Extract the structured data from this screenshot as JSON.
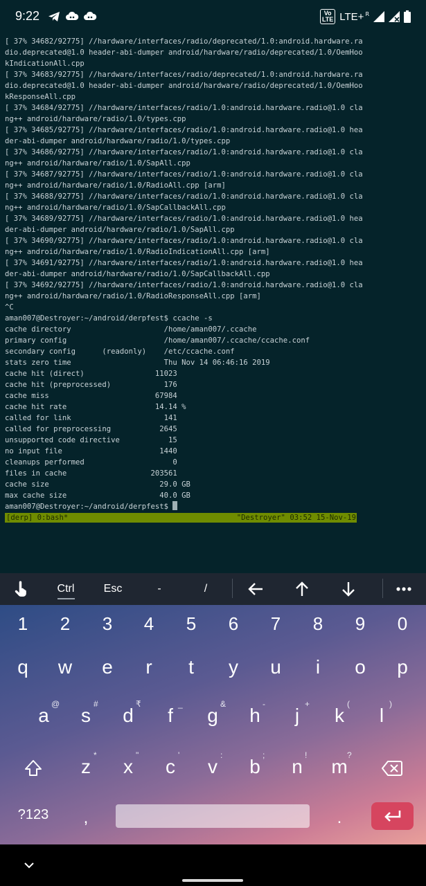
{
  "status_bar": {
    "time": "9:22",
    "volte_label": "Vo\nLTE",
    "network": "LTE+",
    "roaming": "R",
    "notification_icons": [
      "telegram-icon",
      "cloud-sync-icon",
      "cloud-sync-icon"
    ],
    "status_icons": [
      "signal-icon",
      "no-signal-icon",
      "battery-icon"
    ]
  },
  "terminal": {
    "lines": [
      "[ 37% 34682/92775] //hardware/interfaces/radio/deprecated/1.0:android.hardware.ra",
      "dio.deprecated@1.0 header-abi-dumper android/hardware/radio/deprecated/1.0/OemHoo",
      "kIndicationAll.cpp",
      "[ 37% 34683/92775] //hardware/interfaces/radio/deprecated/1.0:android.hardware.ra",
      "dio.deprecated@1.0 header-abi-dumper android/hardware/radio/deprecated/1.0/OemHoo",
      "kResponseAll.cpp",
      "[ 37% 34684/92775] //hardware/interfaces/radio/1.0:android.hardware.radio@1.0 cla",
      "ng++ android/hardware/radio/1.0/types.cpp",
      "[ 37% 34685/92775] //hardware/interfaces/radio/1.0:android.hardware.radio@1.0 hea",
      "der-abi-dumper android/hardware/radio/1.0/types.cpp",
      "[ 37% 34686/92775] //hardware/interfaces/radio/1.0:android.hardware.radio@1.0 cla",
      "ng++ android/hardware/radio/1.0/SapAll.cpp",
      "[ 37% 34687/92775] //hardware/interfaces/radio/1.0:android.hardware.radio@1.0 cla",
      "ng++ android/hardware/radio/1.0/RadioAll.cpp [arm]",
      "[ 37% 34688/92775] //hardware/interfaces/radio/1.0:android.hardware.radio@1.0 cla",
      "ng++ android/hardware/radio/1.0/SapCallbackAll.cpp",
      "[ 37% 34689/92775] //hardware/interfaces/radio/1.0:android.hardware.radio@1.0 hea",
      "der-abi-dumper android/hardware/radio/1.0/SapAll.cpp",
      "[ 37% 34690/92775] //hardware/interfaces/radio/1.0:android.hardware.radio@1.0 cla",
      "ng++ android/hardware/radio/1.0/RadioIndicationAll.cpp [arm]",
      "[ 37% 34691/92775] //hardware/interfaces/radio/1.0:android.hardware.radio@1.0 hea",
      "der-abi-dumper android/hardware/radio/1.0/SapCallbackAll.cpp",
      "[ 37% 34692/92775] //hardware/interfaces/radio/1.0:android.hardware.radio@1.0 cla",
      "ng++ android/hardware/radio/1.0/RadioResponseAll.cpp [arm]",
      "^C",
      "aman007@Destroyer:~/android/derpfest$ ccache -s",
      "cache directory                     /home/aman007/.ccache",
      "primary config                      /home/aman007/.ccache/ccache.conf",
      "secondary config      (readonly)    /etc/ccache.conf",
      "stats zero time                     Thu Nov 14 06:46:16 2019",
      "cache hit (direct)                11023",
      "cache hit (preprocessed)            176",
      "cache miss                        67984",
      "cache hit rate                    14.14 %",
      "called for link                     141",
      "called for preprocessing           2645",
      "unsupported code directive           15",
      "no input file                      1440",
      "cleanups performed                    0",
      "files in cache                   203561",
      "cache size                         29.0 GB",
      "max cache size                     40.0 GB"
    ],
    "prompt": "aman007@Destroyer:~/android/derpfest$ "
  },
  "tmux": {
    "left": "[derp] 0:bash*",
    "right": "\"Destroyer\" 03:52 15-Nov-19"
  },
  "extra_keys": {
    "keyboard_toggle_icon": "touch-hand-icon",
    "ctrl": "Ctrl",
    "esc": "Esc",
    "dash": "-",
    "slash": "/",
    "left_icon": "arrow-left-icon",
    "up_icon": "arrow-up-icon",
    "down_icon": "arrow-down-icon",
    "more_icon": "more-horizontal-icon"
  },
  "keyboard": {
    "numbers": [
      "1",
      "2",
      "3",
      "4",
      "5",
      "6",
      "7",
      "8",
      "9",
      "0"
    ],
    "row1": [
      "q",
      "w",
      "e",
      "r",
      "t",
      "y",
      "u",
      "i",
      "o",
      "p"
    ],
    "row2": [
      {
        "k": "a",
        "h": "@"
      },
      {
        "k": "s",
        "h": "#"
      },
      {
        "k": "d",
        "h": "₹"
      },
      {
        "k": "f",
        "h": "_"
      },
      {
        "k": "g",
        "h": "&"
      },
      {
        "k": "h",
        "h": "-"
      },
      {
        "k": "j",
        "h": "+"
      },
      {
        "k": "k",
        "h": "("
      },
      {
        "k": "l",
        "h": ")"
      }
    ],
    "row3": [
      {
        "k": "z",
        "h": "*"
      },
      {
        "k": "x",
        "h": "\""
      },
      {
        "k": "c",
        "h": "'"
      },
      {
        "k": "v",
        "h": ":"
      },
      {
        "k": "b",
        "h": ";"
      },
      {
        "k": "n",
        "h": "!"
      },
      {
        "k": "m",
        "h": "?"
      }
    ],
    "symbols_key": "?123",
    "comma": ",",
    "period": ".",
    "shift_icon": "shift-icon",
    "backspace_icon": "backspace-icon",
    "enter_icon": "enter-icon"
  },
  "nav": {
    "back_icon": "chevron-down-icon"
  }
}
